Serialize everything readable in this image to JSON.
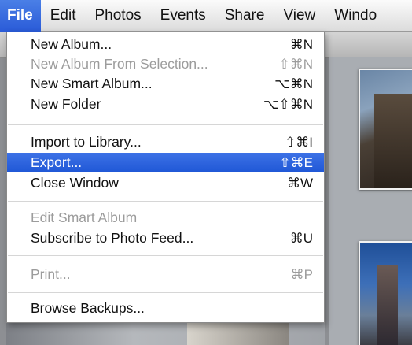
{
  "menubar": {
    "items": [
      {
        "label": "File"
      },
      {
        "label": "Edit"
      },
      {
        "label": "Photos"
      },
      {
        "label": "Events"
      },
      {
        "label": "Share"
      },
      {
        "label": "View"
      },
      {
        "label": "Windo"
      }
    ]
  },
  "file_menu": {
    "items": [
      {
        "label": "New Album...",
        "shortcut": "⌘N",
        "enabled": true
      },
      {
        "label": "New Album From Selection...",
        "shortcut": "⇧⌘N",
        "enabled": false
      },
      {
        "label": "New Smart Album...",
        "shortcut": "⌥⌘N",
        "enabled": true
      },
      {
        "label": "New Folder",
        "shortcut": "⌥⇧⌘N",
        "enabled": true
      },
      {
        "label": "Import to Library...",
        "shortcut": "⇧⌘I",
        "enabled": true
      },
      {
        "label": "Export...",
        "shortcut": "⇧⌘E",
        "enabled": true,
        "highlighted": true
      },
      {
        "label": "Close Window",
        "shortcut": "⌘W",
        "enabled": true
      },
      {
        "label": "Edit Smart Album",
        "shortcut": "",
        "enabled": false
      },
      {
        "label": "Subscribe to Photo Feed...",
        "shortcut": "⌘U",
        "enabled": true
      },
      {
        "label": "Print...",
        "shortcut": "⌘P",
        "enabled": false
      },
      {
        "label": "Browse Backups...",
        "shortcut": "",
        "enabled": true
      }
    ]
  },
  "colors": {
    "highlight": "#2a5bd8",
    "disabled_text": "#9c9c9c"
  }
}
